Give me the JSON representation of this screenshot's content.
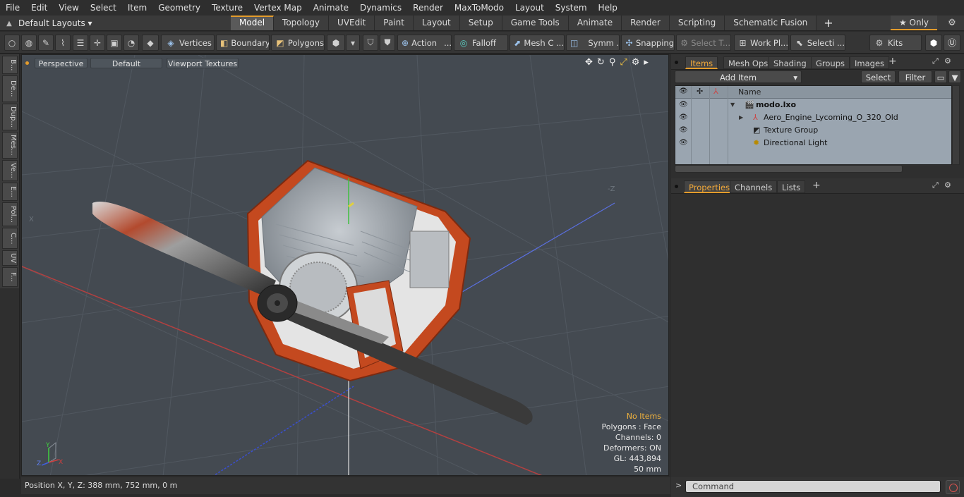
{
  "menu": [
    "File",
    "Edit",
    "View",
    "Select",
    "Item",
    "Geometry",
    "Texture",
    "Vertex Map",
    "Animate",
    "Dynamics",
    "Render",
    "MaxToModo",
    "Layout",
    "System",
    "Help"
  ],
  "layout_bar": {
    "layout_select": "Default Layouts ▾",
    "tabs": [
      "Model",
      "Topology",
      "UVEdit",
      "Paint",
      "Layout",
      "Setup",
      "Game Tools",
      "Animate",
      "Render",
      "Scripting",
      "Schematic Fusion"
    ],
    "active_tab": "Model",
    "only_label": "★ Only"
  },
  "toolbar": {
    "vertices": "Vertices",
    "boundary": "Boundary",
    "polygons": "Polygons",
    "action": "Action",
    "falloff": "Falloff",
    "mesh_c": "Mesh C ...",
    "symm": "Symm ...",
    "snapping": "Snapping",
    "select_t": "Select T...",
    "work_pl": "Work Pl...",
    "selecti": "Selecti ...",
    "kits": "Kits"
  },
  "left_tabs": [
    "B...",
    "De...",
    "Dup...",
    "Mes...",
    "Ve...",
    "E...",
    "Pol...",
    "C...",
    "UV",
    "F..."
  ],
  "viewport": {
    "perspective": "Perspective",
    "default": "Default",
    "textures": "Viewport Textures",
    "info": {
      "no_items": "No Items",
      "polygons": "Polygons : Face",
      "channels": "Channels: 0",
      "deformers": "Deformers: ON",
      "gl": "GL: 443,894",
      "scale": "50 mm"
    },
    "axis_labels": {
      "x": "X",
      "y": "Y",
      "z": "Z"
    },
    "bg_labels": {
      "z_far": "-Z",
      "x_far": "X"
    }
  },
  "status": "Position X, Y, Z:   388 mm, 752 mm, 0 m",
  "items_panel": {
    "tabs": [
      "Items",
      "Mesh Ops",
      "Shading",
      "Groups",
      "Images"
    ],
    "active_tab": "Items",
    "add_item": "Add Item",
    "select": "Select",
    "filter": "Filter",
    "column_name": "Name",
    "rows": [
      {
        "label": "modo.lxo",
        "bold": true
      },
      {
        "label": "Aero_Engine_Lycoming_O_320_Old",
        "bold": false
      },
      {
        "label": "Texture Group",
        "bold": false
      },
      {
        "label": "Directional Light",
        "bold": false
      }
    ]
  },
  "props_panel": {
    "tabs": [
      "Properties",
      "Channels",
      "Lists"
    ],
    "active_tab": "Properties"
  },
  "command": {
    "prompt": ">",
    "placeholder": "Command"
  },
  "colors": {
    "accent": "#e39c2c",
    "viewport_bg": "#444a51",
    "item_list_bg": "#9aa5b0",
    "cowl_orange": "#c4491f"
  }
}
